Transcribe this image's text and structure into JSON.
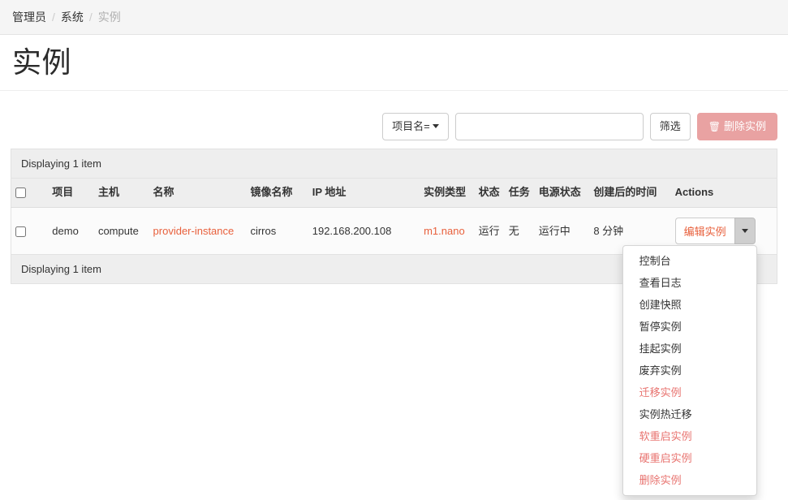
{
  "breadcrumb": {
    "items": [
      {
        "label": "管理员",
        "active": false
      },
      {
        "label": "系统",
        "active": false
      },
      {
        "label": "实例",
        "active": true
      }
    ],
    "separator": "/"
  },
  "page": {
    "title": "实例"
  },
  "toolbar": {
    "filter_select_label": "项目名=",
    "search_value": "",
    "search_placeholder": "",
    "filter_button_label": "筛选",
    "delete_button_label": "删除实例",
    "delete_icon": "trash-icon"
  },
  "table": {
    "caption": "Displaying 1 item",
    "footer": "Displaying 1 item",
    "headers": [
      {
        "key": "checkbox",
        "label": ""
      },
      {
        "key": "project",
        "label": "项目"
      },
      {
        "key": "host",
        "label": "主机"
      },
      {
        "key": "name",
        "label": "名称"
      },
      {
        "key": "image",
        "label": "镜像名称"
      },
      {
        "key": "ip",
        "label": "IP 地址"
      },
      {
        "key": "flavor",
        "label": "实例类型"
      },
      {
        "key": "status",
        "label": "状态"
      },
      {
        "key": "task",
        "label": "任务"
      },
      {
        "key": "power",
        "label": "电源状态"
      },
      {
        "key": "created",
        "label": "创建后的时间"
      },
      {
        "key": "actions",
        "label": "Actions"
      }
    ],
    "rows": [
      {
        "selected": false,
        "project": "demo",
        "host": "compute",
        "name": "provider-instance",
        "image": "cirros",
        "ip": "192.168.200.108",
        "flavor": "m1.nano",
        "status": "运行",
        "task": "无",
        "power": "运行中",
        "created": "8 分钟",
        "action_label": "编辑实例"
      }
    ]
  },
  "actions_menu": {
    "open": true,
    "items": [
      {
        "label": "控制台",
        "danger": false
      },
      {
        "label": "查看日志",
        "danger": false
      },
      {
        "label": "创建快照",
        "danger": false
      },
      {
        "label": "暂停实例",
        "danger": false
      },
      {
        "label": "挂起实例",
        "danger": false
      },
      {
        "label": "废弃实例",
        "danger": false
      },
      {
        "label": "迁移实例",
        "danger": true
      },
      {
        "label": "实例热迁移",
        "danger": false
      },
      {
        "label": "软重启实例",
        "danger": true
      },
      {
        "label": "硬重启实例",
        "danger": true
      },
      {
        "label": "删除实例",
        "danger": true
      }
    ]
  },
  "colors": {
    "link": "#e8603c",
    "danger": "#e8736f",
    "delete_button_bg": "#e9a2a2",
    "header_bg": "#eeeeee",
    "breadcrumb_bg": "#f5f5f5"
  }
}
